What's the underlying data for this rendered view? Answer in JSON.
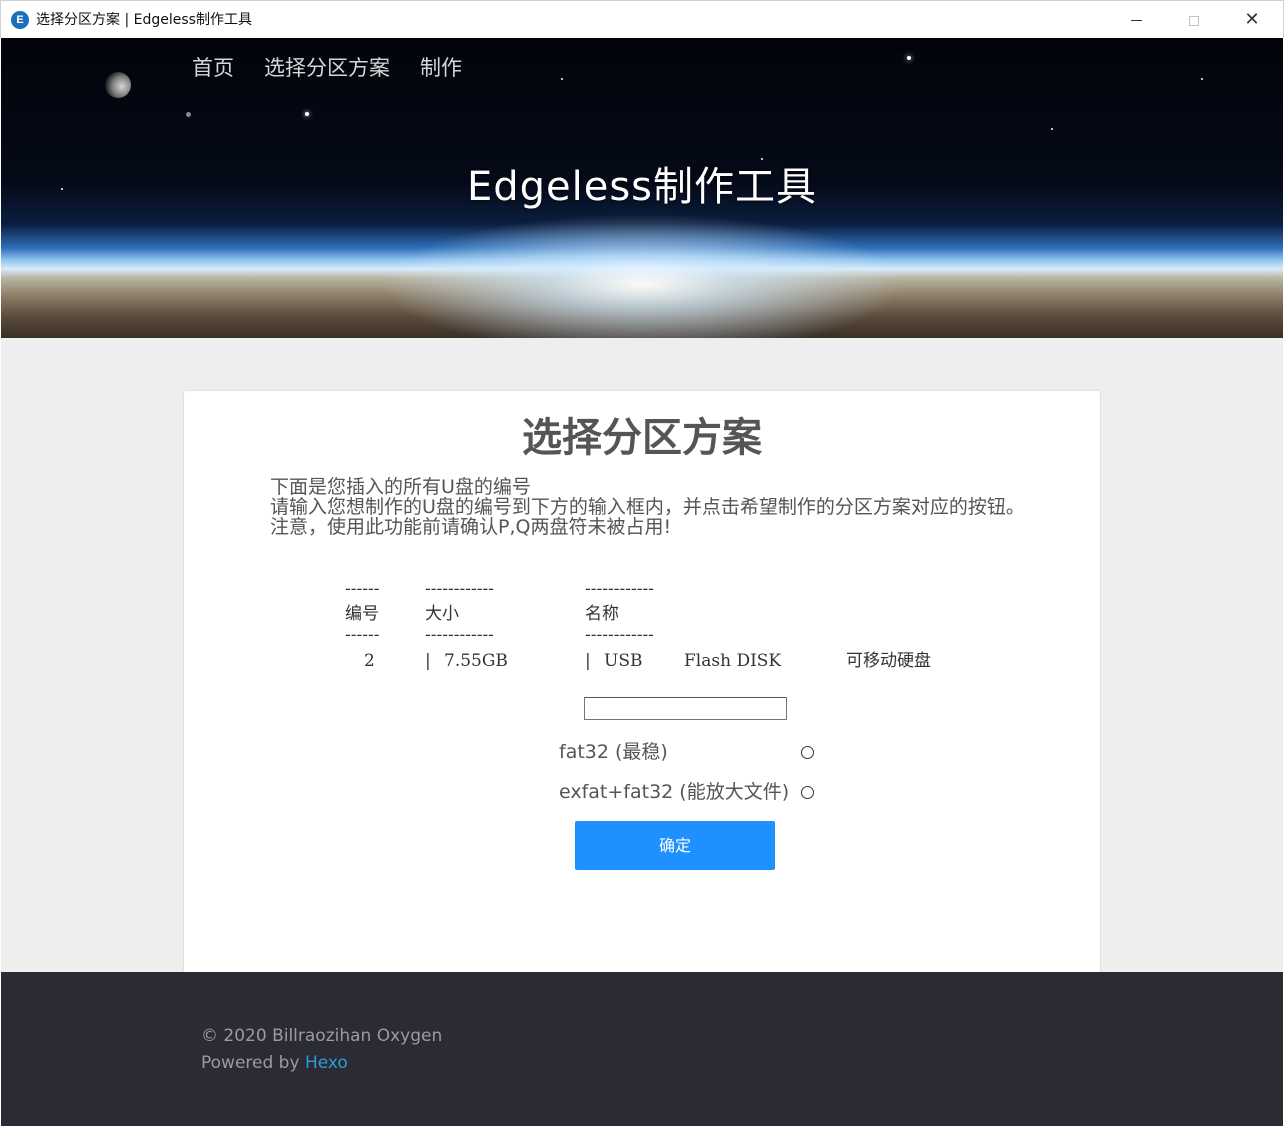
{
  "window": {
    "icon_letter": "E",
    "title": "选择分区方案 | Edgeless制作工具",
    "minimize_icon": "minimize-icon",
    "maximize_icon": "maximize-icon",
    "close_glyph": "✕"
  },
  "nav": {
    "items": [
      {
        "label": "首页"
      },
      {
        "label": "选择分区方案"
      },
      {
        "label": "制作"
      }
    ]
  },
  "hero": {
    "title": "Edgeless制作工具"
  },
  "card": {
    "title": "选择分区方案",
    "intro": [
      "下面是您插入的所有U盘的编号",
      "请输入您想制作的U盘的编号到下方的输入框内，并点击希望制作的分区方案对应的按钮。",
      "注意，使用此功能前请确认P,Q两盘符未被占用!"
    ]
  },
  "disk_table": {
    "separator_short": "------",
    "separator_long": "------------",
    "headers": {
      "number": "编号",
      "size": "大小",
      "name": "名称"
    },
    "rows": [
      {
        "number": "2",
        "size_sep": "|",
        "size": "7.55GB",
        "name_sep": "|",
        "name_part1": "USB",
        "name_part2": "Flash DISK",
        "type": "可移动硬盘"
      }
    ]
  },
  "form": {
    "disk_number_value": "",
    "options": [
      {
        "label": "fat32 (最稳)",
        "selected": false
      },
      {
        "label": "exfat+fat32 (能放大文件)",
        "selected": false
      }
    ],
    "confirm_label": "确定"
  },
  "footer": {
    "copyright": "© 2020 Billraozihan Oxygen",
    "powered_prefix": "Powered by ",
    "powered_link": "Hexo"
  },
  "colors": {
    "accent": "#1e90ff",
    "footer_bg": "#2a2b33",
    "link": "#2e9bdc",
    "content_bg": "#eeeeee"
  }
}
